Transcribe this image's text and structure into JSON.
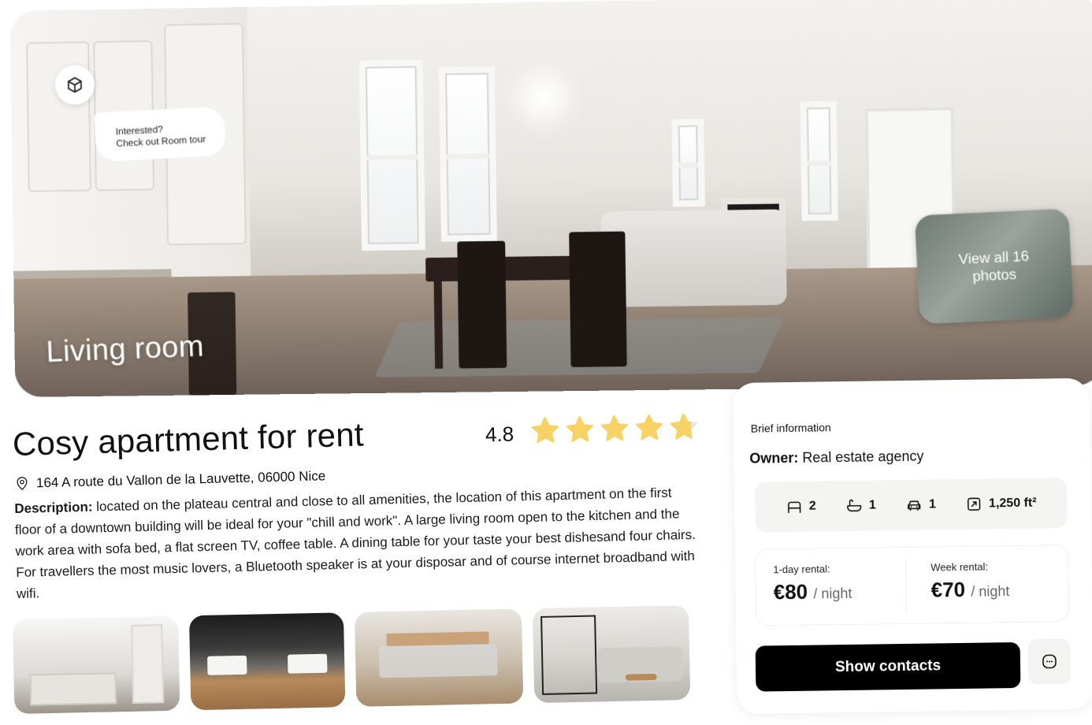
{
  "hero": {
    "tour_prompt_line1": "Interested?",
    "tour_prompt_line2": "Check out Room tour",
    "room_label": "Living room",
    "view_all_line1": "View all 16",
    "view_all_line2": "photos"
  },
  "listing": {
    "title": "Cosy apartment for rent",
    "rating": "4.8",
    "rating_stars": 4.8,
    "rating_max": 5,
    "address": "164 A route du Vallon de la Lauvette, 06000 Nice",
    "description_label": "Description:",
    "description_text": " located on the plateau central and close to all amenities, the location of this apartment on the first floor of a downtown building will be ideal for your \"chill and work\".  A large living room open to the kitchen and the work area with sofa bed, a flat screen TV, coffee table. A dining table for your taste your best dishesand four chairs. For travellers the most music lovers, a Bluetooth speaker is at your disposar and of course internet broadband with wifi."
  },
  "card": {
    "section_label": "Brief information",
    "owner_label": "Owner:",
    "owner_value": " Real estate agency",
    "features": [
      {
        "icon": "bed-icon",
        "value": "2"
      },
      {
        "icon": "bath-icon",
        "value": "1"
      },
      {
        "icon": "car-icon",
        "value": "1"
      },
      {
        "icon": "area-icon",
        "value": "1,250 ft²"
      }
    ],
    "day_rental_label": "1-day rental:",
    "day_rental_price": "€80",
    "week_rental_label": "Week rental:",
    "week_rental_price": "€70",
    "price_unit": "/ night",
    "contacts_button": "Show contacts"
  },
  "colors": {
    "star": "#F7D366",
    "button": "#000000"
  }
}
